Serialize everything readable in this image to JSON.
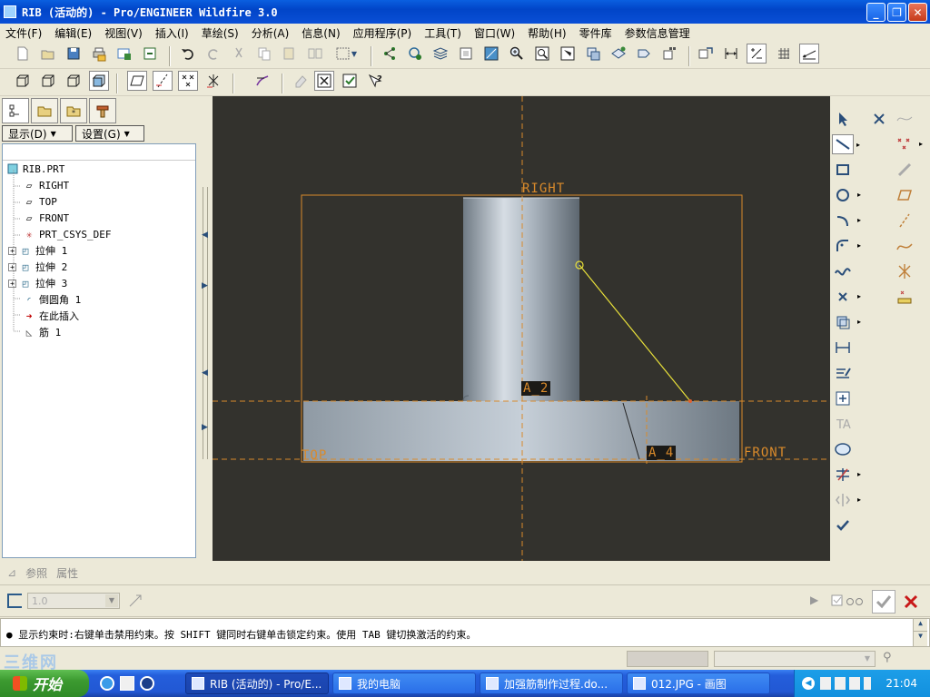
{
  "window": {
    "title": "RIB (活动的) - Pro/ENGINEER Wildfire 3.0",
    "minimize_glyph": "_",
    "restore_glyph": "❐",
    "close_glyph": "✕"
  },
  "menu": [
    "文件(F)",
    "编辑(E)",
    "视图(V)",
    "插入(I)",
    "草绘(S)",
    "分析(A)",
    "信息(N)",
    "应用程序(P)",
    "工具(T)",
    "窗口(W)",
    "帮助(H)",
    "零件库",
    "参数信息管理"
  ],
  "left_panel": {
    "show_button": "显示(D)",
    "settings_button": "设置(G)",
    "tree": {
      "root": "RIB.PRT",
      "items": [
        {
          "label": "RIGHT",
          "icon": "datum-plane-icon"
        },
        {
          "label": "TOP",
          "icon": "datum-plane-icon"
        },
        {
          "label": "FRONT",
          "icon": "datum-plane-icon"
        },
        {
          "label": "PRT_CSYS_DEF",
          "icon": "csys-icon"
        },
        {
          "label": "拉伸 1",
          "icon": "extrude-icon",
          "expandable": true
        },
        {
          "label": "拉伸 2",
          "icon": "extrude-icon",
          "expandable": true
        },
        {
          "label": "拉伸 3",
          "icon": "extrude-icon",
          "expandable": true
        },
        {
          "label": "倒圆角 1",
          "icon": "round-icon"
        },
        {
          "label": "在此插入",
          "icon": "insert-here-icon"
        },
        {
          "label": "筋 1",
          "icon": "rib-icon"
        }
      ]
    }
  },
  "viewport": {
    "labels": {
      "right": "RIGHT",
      "top": "TOP",
      "front": "FRONT",
      "a2": "A_2",
      "a4": "A_4"
    },
    "colors": {
      "background": "#33322d",
      "datum": "#d98a2b",
      "sketch_line": "#e8e03a"
    }
  },
  "bottom_tabs": {
    "references": "参照",
    "properties": "属性"
  },
  "dashboard": {
    "thickness_value": "1.0"
  },
  "message": "● 显示约束时:右键单击禁用约束。按 SHIFT 键同时右键单击锁定约束。使用 TAB 键切换激活的约束。",
  "taskbar": {
    "start": "开始",
    "watermark": "三维网",
    "tasks": [
      "RIB (活动的) - Pro/E...",
      "我的电脑",
      "加强筋制作过程.do...",
      "012.JPG - 画图"
    ],
    "clock": "21:04"
  }
}
